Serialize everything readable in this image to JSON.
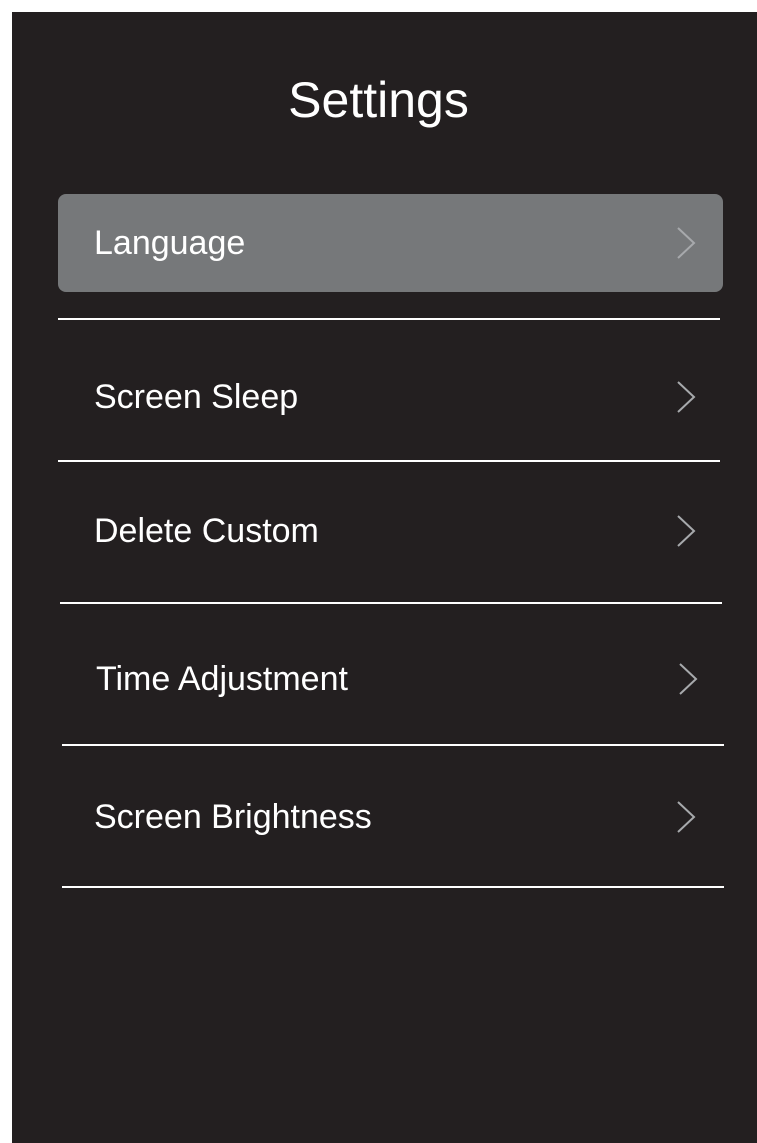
{
  "header": {
    "title": "Settings"
  },
  "menu": {
    "items": [
      {
        "label": "Language",
        "selected": true,
        "icon": "chevron-right-icon"
      },
      {
        "label": "Screen Sleep",
        "selected": false,
        "icon": "chevron-right-icon"
      },
      {
        "label": "Delete Custom",
        "selected": false,
        "icon": "chevron-right-icon"
      },
      {
        "label": "Time Adjustment",
        "selected": false,
        "icon": "chevron-right-icon"
      },
      {
        "label": "Screen Brightness",
        "selected": false,
        "icon": "chevron-right-icon"
      }
    ]
  },
  "colors": {
    "background": "#231f20",
    "selected_item": "#76787a",
    "text": "#ffffff",
    "chevron": "#a7a9ac",
    "frame": "#ffffff"
  }
}
